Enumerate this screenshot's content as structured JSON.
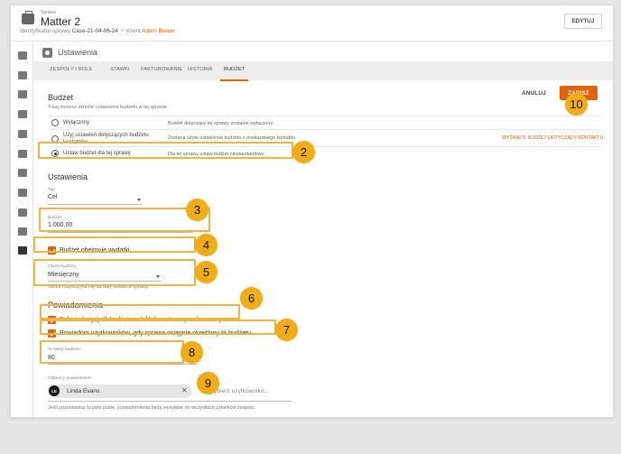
{
  "header": {
    "supertitle": "Sprawa",
    "title": "Matter 2",
    "id_label": "Identyfikator sprawy",
    "id_value": "Case-21-04-06-24",
    "separator": "•",
    "client_label": "Klient",
    "client_value": "Adam Brown",
    "edit_button": "EDYTUJ"
  },
  "section_title": "Ustawienia",
  "tabs": [
    {
      "label": "ZESPOŁY I ROLE"
    },
    {
      "label": "STAWKI"
    },
    {
      "label": "FAKTUROWANIE"
    },
    {
      "label": "HISTORIA"
    },
    {
      "label": "BUDŻET",
      "active": true
    }
  ],
  "budget": {
    "title": "Budżet",
    "subtitle": "Tutaj możesz określić ustawienia budżetu w tej sprawie.",
    "cancel": "ANULUJ",
    "save": "ZAPISZ",
    "options": [
      {
        "label": "Wyłączony",
        "desc": "Budżet dotyczący tej sprawy zostanie wyłączony."
      },
      {
        "label": "Użyj ustawień dotyczących budżetu kontaktów",
        "desc": "Zostaną użyte ustawienia budżetu z powiązanego kontaktu."
      },
      {
        "label": "Ustaw budżet dla tej sprawy",
        "desc": "Dla tej sprawy ustaw budżet niestandardowy",
        "selected": true
      }
    ],
    "contact_link": "WYŚWIETL BUDŻET DOTYCZĄCY KONTAKTU"
  },
  "settings": {
    "title": "Ustawienia",
    "type_label": "Typ",
    "type_value": "Cel",
    "budget_label": "Budżet",
    "budget_value": "1 000.00",
    "expenses_label": "Budżet obejmuje wydatki",
    "period_label": "Okres budżetu",
    "period_value": "Miesięczny",
    "period_hint": "Okres rozpoczyna się od daty otwarcia sprawy"
  },
  "notifications": {
    "title": "Powiadomienia",
    "alert_label": "Pokaż alerty, jeśli budżet został lub zostanie przekroczony.",
    "notify_label": "Powiadom użytkowników, gdy sprawa osiągnie określony % budżetu",
    "threshold_label": "% Alerty budżetu",
    "threshold_value": "80",
    "recipients_label": "Odbiorcy powiadomień",
    "recipient_initials": "LE",
    "recipient_name": "Linda Evans",
    "recipient_remove": "✕",
    "add_placeholder": "Wybierz użytkownikó...",
    "hint": "Jeśli pozostawisz to pole puste, powiadomienia będą wysyłane do wszystkich członków zespołu"
  },
  "annotations": [
    "2",
    "3",
    "4",
    "5",
    "6",
    "7",
    "8",
    "9",
    "10"
  ],
  "colors": {
    "accent": "#e2630a",
    "highlight": "#f0b53c",
    "badge": "#f2ad16"
  }
}
